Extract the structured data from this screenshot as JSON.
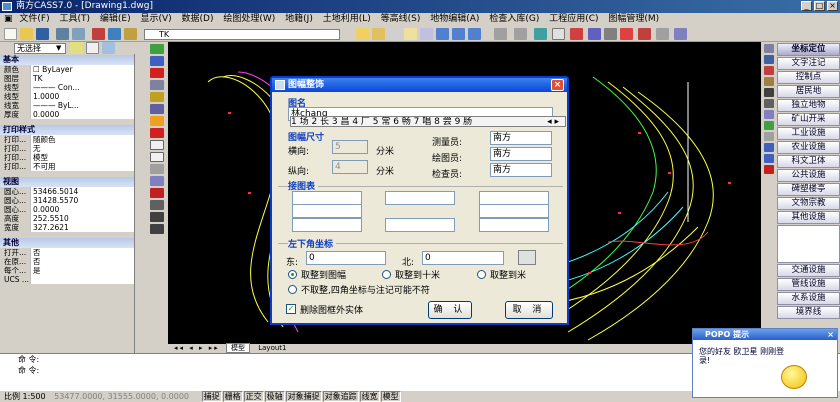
{
  "app": {
    "title": "南方CASS7.0 - [Drawing1.dwg]"
  },
  "menu": [
    "文件(F)",
    "工具(T)",
    "编辑(E)",
    "显示(V)",
    "数据(D)",
    "绘图处理(W)",
    "地籍(J)",
    "土地利用(L)",
    "等高线(S)",
    "地物编辑(A)",
    "检查入库(G)",
    "工程应用(C)",
    "图幅管理(M)"
  ],
  "layer": {
    "current": "TK",
    "selector": "无选择"
  },
  "properties": {
    "basic_header": "基本",
    "basic": [
      [
        "颜色",
        "☐ ByLayer"
      ],
      [
        "图层",
        "TK"
      ],
      [
        "线型",
        "——— Con..."
      ],
      [
        "线型",
        "1.0000"
      ],
      [
        "线宽",
        "——— ByL..."
      ],
      [
        "厚度",
        "0.0000"
      ]
    ],
    "print_header": "打印样式",
    "print": [
      [
        "打印...",
        "随颜色"
      ],
      [
        "打印...",
        "无"
      ],
      [
        "打印...",
        "模型"
      ],
      [
        "打印...",
        "不可用"
      ]
    ],
    "view_header": "视图",
    "view": [
      [
        "圆心...",
        "53466.5014"
      ],
      [
        "圆心...",
        "31428.5570"
      ],
      [
        "圆心...",
        "0.0000"
      ],
      [
        "高度",
        "252.5510"
      ],
      [
        "宽度",
        "327.2621"
      ]
    ],
    "other_header": "其他",
    "other": [
      [
        "打开...",
        "否"
      ],
      [
        "在原...",
        "否"
      ],
      [
        "每个...",
        "是"
      ],
      [
        "UCS ...",
        ""
      ]
    ]
  },
  "right_panel": {
    "top": [
      "坐标定位",
      "文字注记",
      "控制点",
      "居民地",
      "独立地物",
      "矿山开采",
      "工业设施",
      "农业设施",
      "科文卫体",
      "公共设施",
      "碑塑楼亭",
      "文物宗教",
      "其他设施"
    ],
    "bottom": [
      "交通设施",
      "管线设施",
      "水系设施",
      "境界线"
    ]
  },
  "layout_tabs": {
    "model": "模型",
    "layout": "Layout1"
  },
  "dialog": {
    "title": "图幅整饰",
    "name_label": "图名",
    "name_value": "林chang",
    "size_label": "图幅尺寸",
    "horizontal_label": "横向:",
    "horizontal_value": "5",
    "vertical_label": "纵向:",
    "vertical_value": "4",
    "unit": "分米",
    "surveyor_label": "测量员:",
    "surveyor_value": "南方",
    "drafter_label": "绘图员:",
    "drafter_value": "南方",
    "checker_label": "检查员:",
    "checker_value": "南方",
    "join_label": "接图表",
    "corner_label": "左下角坐标",
    "east_label": "东:",
    "east_value": "0",
    "north_label": "北:",
    "north_value": "0",
    "round_map": "取整到图幅",
    "round_10m": "取整到十米",
    "round_1m": "取整到米",
    "no_round": "不取整,四角坐标与注记可能不符",
    "delete_outside": "删除图框外实体",
    "ok": "确 认",
    "cancel": "取 消"
  },
  "ime": {
    "candidates": "1 场 2 长 3 昌 4 厂 5 常 6 畅 7 唱 8 尝 9 肠"
  },
  "command": {
    "line1": "命 令:",
    "line2": "命 令:"
  },
  "status": {
    "scale": "比例 1:500",
    "coords": "53477.0000, 31555.0000, 0.0000",
    "buttons": [
      "捕捉",
      "栅格",
      "正交",
      "极轴",
      "对象捕捉",
      "对象追踪",
      "线宽",
      "模型"
    ]
  },
  "popo": {
    "title": "POPO 提示",
    "message": "您的好友 欧卫星 刚刚登录!"
  }
}
